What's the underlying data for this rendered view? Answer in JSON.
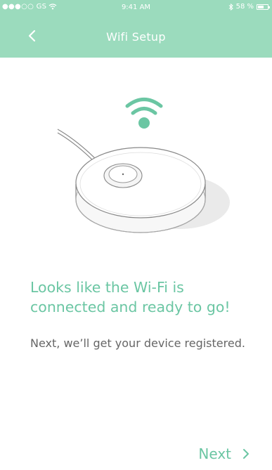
{
  "status_bar": {
    "carrier": "●●●○○ GS",
    "time": "9:41 AM",
    "battery": "58 %"
  },
  "nav": {
    "title": "Wifi Setup",
    "back_icon": "chevron-left-icon"
  },
  "illustration": {
    "wifi_icon": "wifi-icon",
    "device": "hub-device-illustration"
  },
  "content": {
    "headline": "Looks like the Wi-Fi is connected and ready to go!",
    "subtext": "Next, we’ll get your device registered."
  },
  "footer": {
    "next_label": "Next",
    "next_icon": "chevron-right-icon"
  },
  "colors": {
    "accent": "#9bdbbd",
    "text_accent": "#6bc6a3",
    "body_text": "#666666",
    "background": "#ffffff"
  }
}
